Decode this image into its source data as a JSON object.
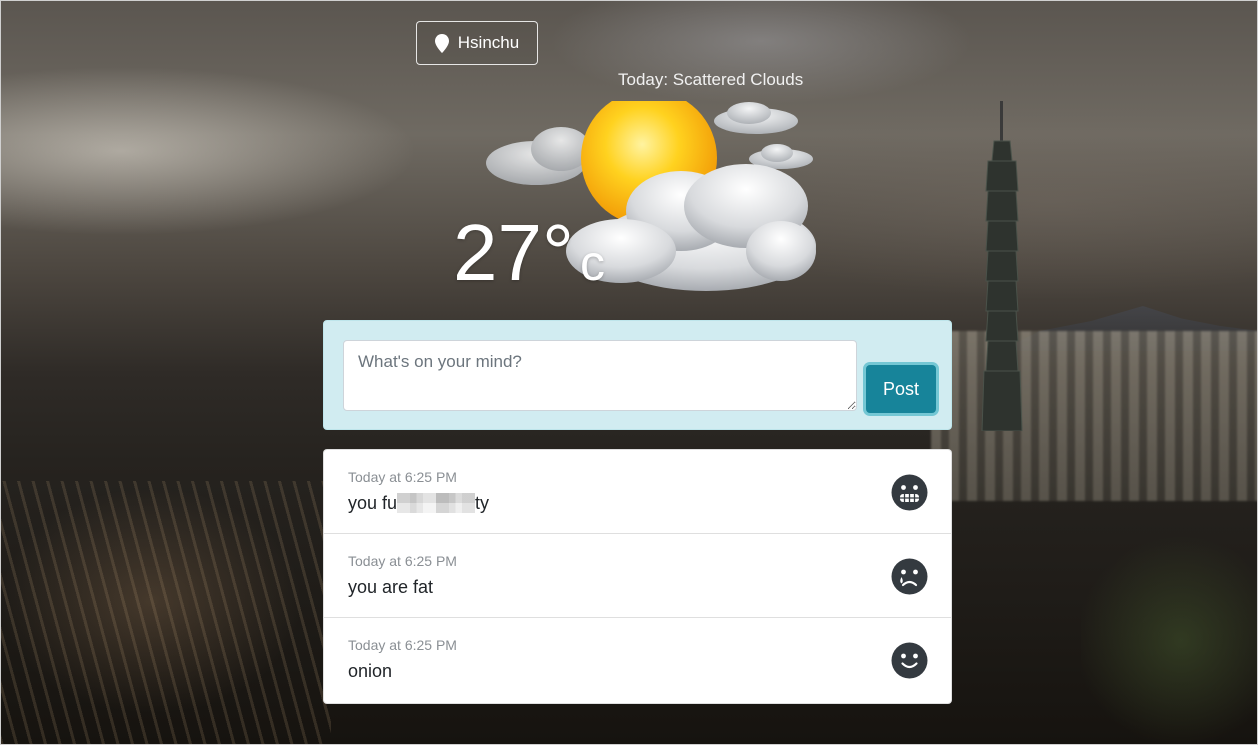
{
  "location": {
    "city": "Hsinchu",
    "icon": "map-pin-icon"
  },
  "weather": {
    "condition_text": "Today: Scattered Clouds",
    "temperature": "27°",
    "unit": "c",
    "icon": "scattered-clouds-sun-icon"
  },
  "composer": {
    "placeholder": "What's on your mind?",
    "value": "",
    "post_label": "Post"
  },
  "posts": [
    {
      "time": "Today at 6:25 PM",
      "text_start": "you fu",
      "text_end": "ty",
      "censored": true,
      "mood_icon": "grimace-face-icon"
    },
    {
      "time": "Today at 6:25 PM",
      "text": "you are fat",
      "mood_icon": "sad-tear-face-icon"
    },
    {
      "time": "Today at 6:25 PM",
      "text": "onion",
      "mood_icon": "smile-face-icon"
    }
  ],
  "colors": {
    "composer_bg": "#d1ecf1",
    "post_button": "#17849a",
    "mood_icon": "#343a40"
  }
}
